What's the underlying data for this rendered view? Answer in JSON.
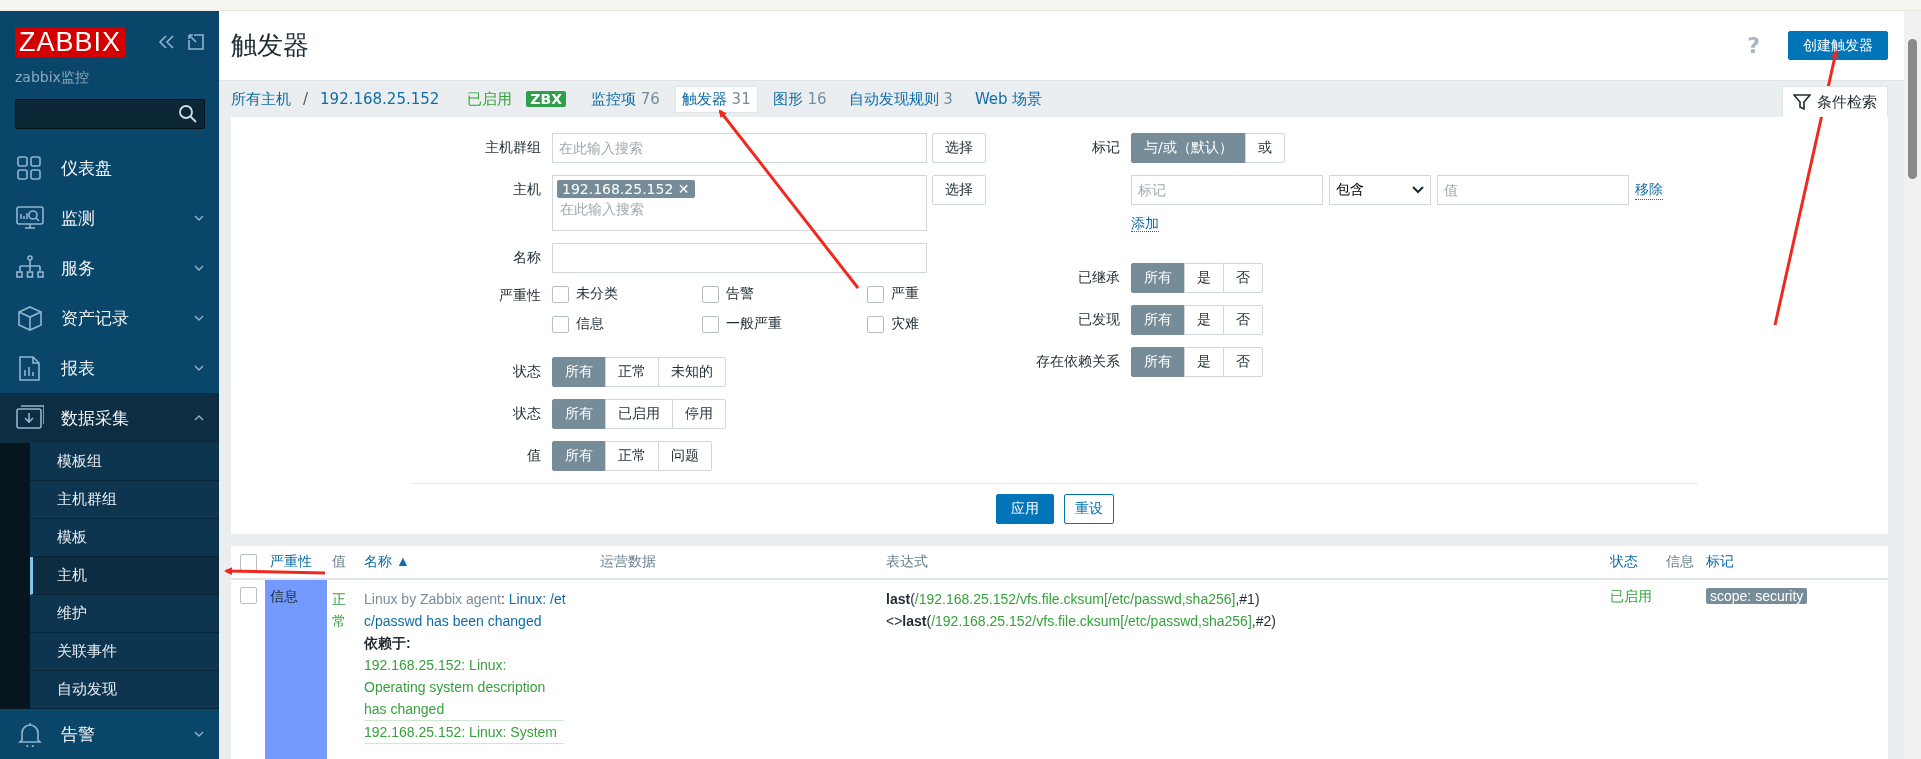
{
  "sidebar": {
    "logo": "ZABBIX",
    "server_name": "zabbix监控",
    "menu": [
      {
        "label": "仪表盘",
        "has_submenu": false,
        "expanded": false
      },
      {
        "label": "监测",
        "has_submenu": true,
        "expanded": false
      },
      {
        "label": "服务",
        "has_submenu": true,
        "expanded": false
      },
      {
        "label": "资产记录",
        "has_submenu": true,
        "expanded": false
      },
      {
        "label": "报表",
        "has_submenu": true,
        "expanded": false
      },
      {
        "label": "数据采集",
        "has_submenu": true,
        "expanded": true,
        "children": [
          {
            "label": "模板组",
            "selected": false
          },
          {
            "label": "主机群组",
            "selected": false
          },
          {
            "label": "模板",
            "selected": false
          },
          {
            "label": "主机",
            "selected": true
          },
          {
            "label": "维护",
            "selected": false
          },
          {
            "label": "关联事件",
            "selected": false
          },
          {
            "label": "自动发现",
            "selected": false
          }
        ]
      },
      {
        "label": "告警",
        "has_submenu": true,
        "expanded": false
      }
    ]
  },
  "header": {
    "title": "触发器",
    "help": "?",
    "create_button": "创建触发器"
  },
  "nav": {
    "breadcrumbs": [
      "所有主机",
      "/",
      "192.168.25.152"
    ],
    "status": "已启用",
    "tag": "ZBX",
    "tabs": [
      {
        "label": "监控项",
        "count": "76",
        "selected": false
      },
      {
        "label": "触发器",
        "count": "31",
        "selected": true
      },
      {
        "label": "图形",
        "count": "16",
        "selected": false
      },
      {
        "label": "自动发现规则",
        "count": "3",
        "selected": false
      },
      {
        "label": "Web 场景",
        "selected": false
      }
    ],
    "filter_tab": "条件检索"
  },
  "filter": {
    "left": [
      {
        "kind": "search",
        "label": "主机群组",
        "placeholder": "在此输入搜索",
        "button": "选择"
      },
      {
        "kind": "multiselect",
        "label": "主机",
        "chips": [
          "192.168.25.152"
        ],
        "chip_remove": "✕",
        "placeholder": "在此输入搜索",
        "button": "选择"
      },
      {
        "kind": "text",
        "label": "名称"
      },
      {
        "kind": "checkboxes",
        "label": "严重性",
        "options": [
          {
            "label": "未分类",
            "checked": false
          },
          {
            "label": "告警",
            "checked": false
          },
          {
            "label": "严重",
            "checked": false
          },
          {
            "label": "信息",
            "checked": false
          },
          {
            "label": "一般严重",
            "checked": false
          },
          {
            "label": "灾难",
            "checked": false
          }
        ]
      },
      {
        "kind": "segmented",
        "label": "状态",
        "options": [
          {
            "label": "所有",
            "selected": true
          },
          {
            "label": "正常",
            "selected": false
          },
          {
            "label": "未知的",
            "selected": false
          }
        ]
      },
      {
        "kind": "segmented",
        "label": "状态",
        "options": [
          {
            "label": "所有",
            "selected": true
          },
          {
            "label": "已启用",
            "selected": false
          },
          {
            "label": "停用",
            "selected": false
          }
        ]
      },
      {
        "kind": "segmented",
        "label": "值",
        "options": [
          {
            "label": "所有",
            "selected": true
          },
          {
            "label": "正常",
            "selected": false
          },
          {
            "label": "问题",
            "selected": false
          }
        ]
      }
    ],
    "right": [
      {
        "kind": "segmented",
        "label": "标记",
        "options": [
          {
            "label": "与/或（默认）",
            "selected": true
          },
          {
            "label": "或",
            "selected": false
          }
        ]
      },
      {
        "kind": "tag_filter",
        "tag_placeholder": "标记",
        "operator": "包含",
        "value_placeholder": "值",
        "remove": "移除",
        "add": "添加"
      },
      {
        "kind": "segmented",
        "label": "已继承",
        "options": [
          {
            "label": "所有",
            "selected": true
          },
          {
            "label": "是",
            "selected": false
          },
          {
            "label": "否",
            "selected": false
          }
        ]
      },
      {
        "kind": "segmented",
        "label": "已发现",
        "options": [
          {
            "label": "所有",
            "selected": true
          },
          {
            "label": "是",
            "selected": false
          },
          {
            "label": "否",
            "selected": false
          }
        ]
      },
      {
        "kind": "segmented",
        "label": "存在依赖关系",
        "options": [
          {
            "label": "所有",
            "selected": true
          },
          {
            "label": "是",
            "selected": false
          },
          {
            "label": "否",
            "selected": false
          }
        ]
      }
    ],
    "apply": "应用",
    "reset": "重设"
  },
  "table": {
    "select_all_checked": false,
    "columns": [
      "严重性",
      "值",
      "名称 ▲",
      "运营数据",
      "表达式",
      "状态",
      "信息",
      "标记"
    ],
    "rows": [
      {
        "checked": false,
        "severity": "信息",
        "color": "#7499ff",
        "value": "正常",
        "template": "Linux by Zabbix agent",
        "separator": ": ",
        "name": "Linux: /etc/passwd has been changed",
        "depends_label": "依赖于:",
        "dependencies": [
          "192.168.25.152: Linux: Operating system description has changed",
          "192.168.25.152: Linux: System"
        ],
        "expression": [
          {
            "prefix": "**last**(",
            "item": "/192.168.25.152/vfs.file.cksum[/etc/passwd,sha256]",
            "suffix": ",#1)"
          },
          {
            "prefix": "<>**last**(",
            "item": "/192.168.25.152/vfs.file.cksum[/etc/passwd,sha256]",
            "suffix": ",#2)"
          }
        ],
        "status": "已启用",
        "tags": [
          "scope: security"
        ]
      }
    ]
  }
}
